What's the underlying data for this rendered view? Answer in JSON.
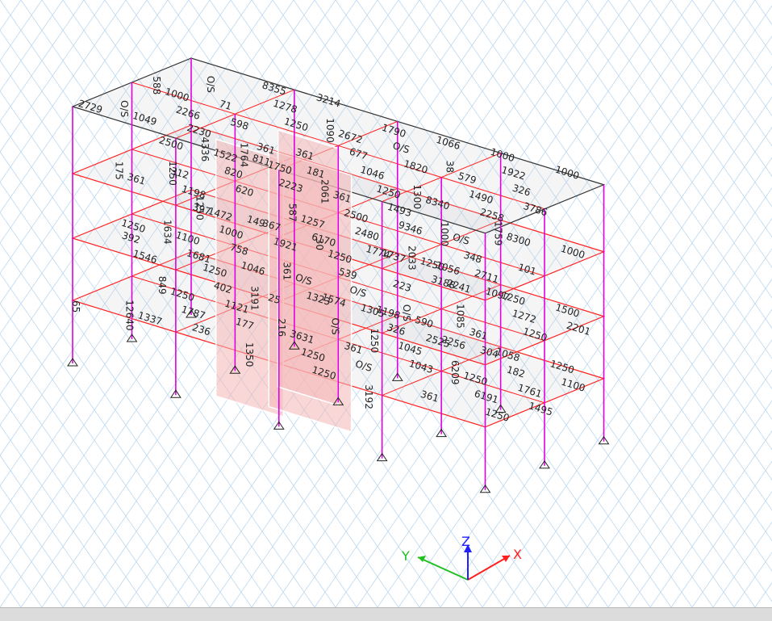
{
  "colors": {
    "background": "#ffffff",
    "grid": "#bcd8f0",
    "beam": "#ff2020",
    "column": "#e000e0",
    "wall_fill": "#f4b7b7",
    "label": "#222222",
    "axis_x": "#ff2020",
    "axis_y": "#20c020",
    "axis_z": "#2020ff",
    "statusbar": "#dcdcdc"
  },
  "axes": {
    "x": "X",
    "y": "Y",
    "z": "Z"
  },
  "labels": [
    "65",
    "392",
    "312",
    "71",
    "25",
    "30",
    "149",
    "361",
    "361",
    "223",
    "1000",
    "1000",
    "361",
    "361",
    "101",
    "588",
    "1250",
    "1546",
    "1198",
    "598",
    "216",
    "1250",
    "1250",
    "181",
    "O/S",
    "O/S",
    "O/S",
    "1922",
    "1250",
    "304",
    "175",
    "1000",
    "402",
    "367",
    "397",
    "1764",
    "3631",
    "539",
    "1493",
    "1066",
    "3192",
    "590",
    "348",
    "326",
    "1100",
    "1250",
    "361",
    "2266",
    "1121",
    "1921",
    "2061",
    "811",
    "1250",
    "O/S",
    "9346",
    "38",
    "1058",
    "2525",
    "2711",
    "3786",
    "849",
    "1472",
    "361",
    "2230",
    "177",
    "361",
    "361",
    "1790",
    "1250",
    "1305",
    "2033",
    "579",
    "182",
    "1500",
    "1097",
    "O/S",
    "1250",
    "1000",
    "1750",
    "3214",
    "1350",
    "O/S",
    "2500",
    "O/S",
    "2256",
    "1250",
    "1250",
    "1490",
    "1761",
    "2201",
    "4336",
    "1049",
    "1787",
    "758",
    "2223",
    "1090",
    "1198",
    "1323",
    "2480",
    "1820",
    "6209",
    "1250",
    "3188",
    "2258",
    "1495",
    "1634",
    "1522",
    "8355",
    "236",
    "1046",
    "587",
    "2672",
    "326",
    "1056",
    "1774",
    "1300",
    "1250",
    "1272",
    "1000",
    "2729",
    "12640",
    "1100",
    "820",
    "1278",
    "1574",
    "3191",
    "1257",
    "677",
    "1045",
    "2241",
    "1759",
    "8340",
    "6191",
    "1250",
    "2500",
    "O/S",
    "1337",
    "1681",
    "620",
    "1250",
    "O/S",
    "1737",
    "6170",
    "1046",
    "1043",
    "1085",
    "8300",
    "1000",
    "1250",
    "1250",
    "1250"
  ]
}
